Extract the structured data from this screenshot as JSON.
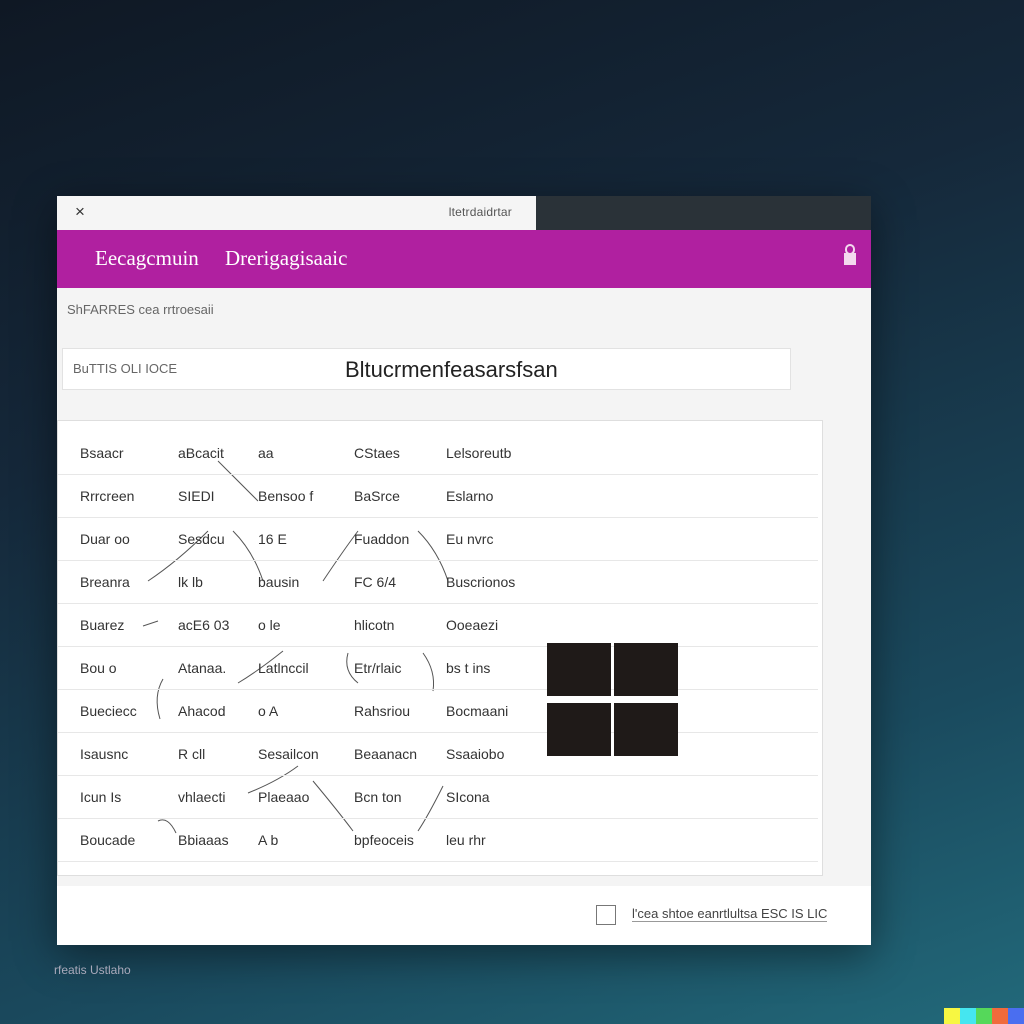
{
  "window": {
    "close_glyph": "×",
    "tab_title": "ltetrdaidrtar",
    "app_title_1": "Eecagcmuin",
    "app_title_2": "Drerigagisaaic",
    "breadcrumb": "ShFARRES cea rrtroesaii",
    "search_label": "BuTTIS OLI IOCE",
    "search_value": "Bltucrmenfeasarsfsan",
    "footer_text": "l'cea shtoe eanrtlultsa ESC IS LIC",
    "caption": "rfeatis Ustlaho"
  },
  "table": {
    "rows": [
      [
        "Bsaacr",
        "aBcacit",
        "aa",
        "CStaes",
        "Lelsoreutb"
      ],
      [
        "Rrrcreen",
        "SIEDI",
        "Bensoo f",
        "BaSrce",
        "Eslarno"
      ],
      [
        "Duar oo",
        "Sesdcu",
        "16  E",
        "Fuaddon",
        "Eu nvrc"
      ],
      [
        "Breanra",
        "lk  lb",
        "bausin",
        "FC 6/4",
        "Buscrionos"
      ],
      [
        "Buarez",
        "acE6 03",
        "o   le",
        "hlicotn",
        "Ooeaezi"
      ],
      [
        "Bou   o",
        "Atanaa.",
        "Latlnccil",
        "Etr/rlaic",
        "bs t ins"
      ],
      [
        "Bueciecc",
        "Ahacod",
        "o   A",
        "Rahsriou",
        "Bocmaani"
      ],
      [
        "Isausnc",
        "R  cll",
        "Sesailcon",
        "Beaanacn",
        "Ssaaiobo"
      ],
      [
        "Icun  Is",
        "vhlaecti",
        "Plaeaao",
        "Bcn ton",
        "SIcona"
      ],
      [
        "Boucade",
        "Bbiaaas",
        "A   b",
        "bpfeoceis",
        "leu  rhr"
      ]
    ]
  },
  "colors": {
    "accent": "#b020a0",
    "titlebar": "#2a3238",
    "logo": "#1f1a18"
  },
  "icons": [
    "close-icon",
    "lock-icon",
    "grid-icon",
    "image-icon"
  ]
}
